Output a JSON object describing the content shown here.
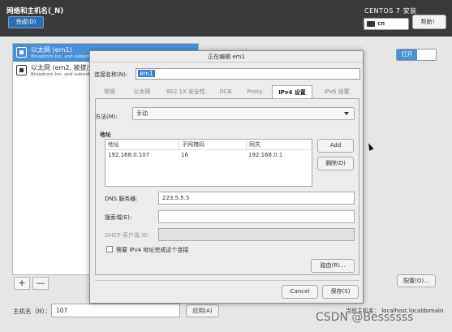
{
  "header": {
    "title": "网络和主机名(_N)",
    "done": "完成(D)",
    "os_title": "CENTOS 7 安装",
    "keyboard": "cn",
    "help": "帮助！"
  },
  "interfaces": [
    {
      "name": "以太网 (em1)",
      "sub": "Broadcom Inc. and subsidiarie"
    },
    {
      "name": "以太网 (em2, 被拔出",
      "sub": "Broadcom Inc. and subsidiarie"
    }
  ],
  "list_controls": {
    "add": "+",
    "remove": "—"
  },
  "toggle_label": "打开",
  "configure_button": "配置(O)...",
  "hostname": {
    "label": "主机名（H）：",
    "value": "107",
    "apply": "应用(A)",
    "current_label": "当前主机名：",
    "current_value": "localhost.localdomain"
  },
  "watermark": "CSDN @Bessssss",
  "dialog": {
    "title": "正在编辑 em1",
    "conn_name_label": "连接名称(N):",
    "conn_name_value": "em1",
    "tabs": [
      "常规",
      "以太网",
      "802.1X 安全性",
      "DCB",
      "Proxy",
      "IPv4 设置",
      "IPv6 设置"
    ],
    "active_tab": "IPv4 设置",
    "method_label": "方法(M):",
    "method_value": "手动",
    "address_title": "地址",
    "columns": [
      "地址",
      "子网掩码",
      "网关"
    ],
    "rows": [
      [
        "192.168.0.107",
        "16",
        "192.168.0.1"
      ]
    ],
    "add_button": "Add",
    "delete_button": "删除(D)",
    "dns_label": "DNS 服务器:",
    "dns_value": "223.5.5.5",
    "search_label": "搜索域(E):",
    "search_value": "",
    "dhcp_label": "DHCP 客户端 ID:",
    "dhcp_value": "",
    "require_ipv4": "需要 IPv4 地址完成这个连接",
    "require_ipv4_checked": false,
    "routes_button": "路由(R)...",
    "cancel": "Cancel",
    "save": "保存(S)"
  },
  "colors": {
    "header_bg": "#3a3a3a",
    "accent": "#4a90d9",
    "done_button": "#2e6fb0"
  }
}
